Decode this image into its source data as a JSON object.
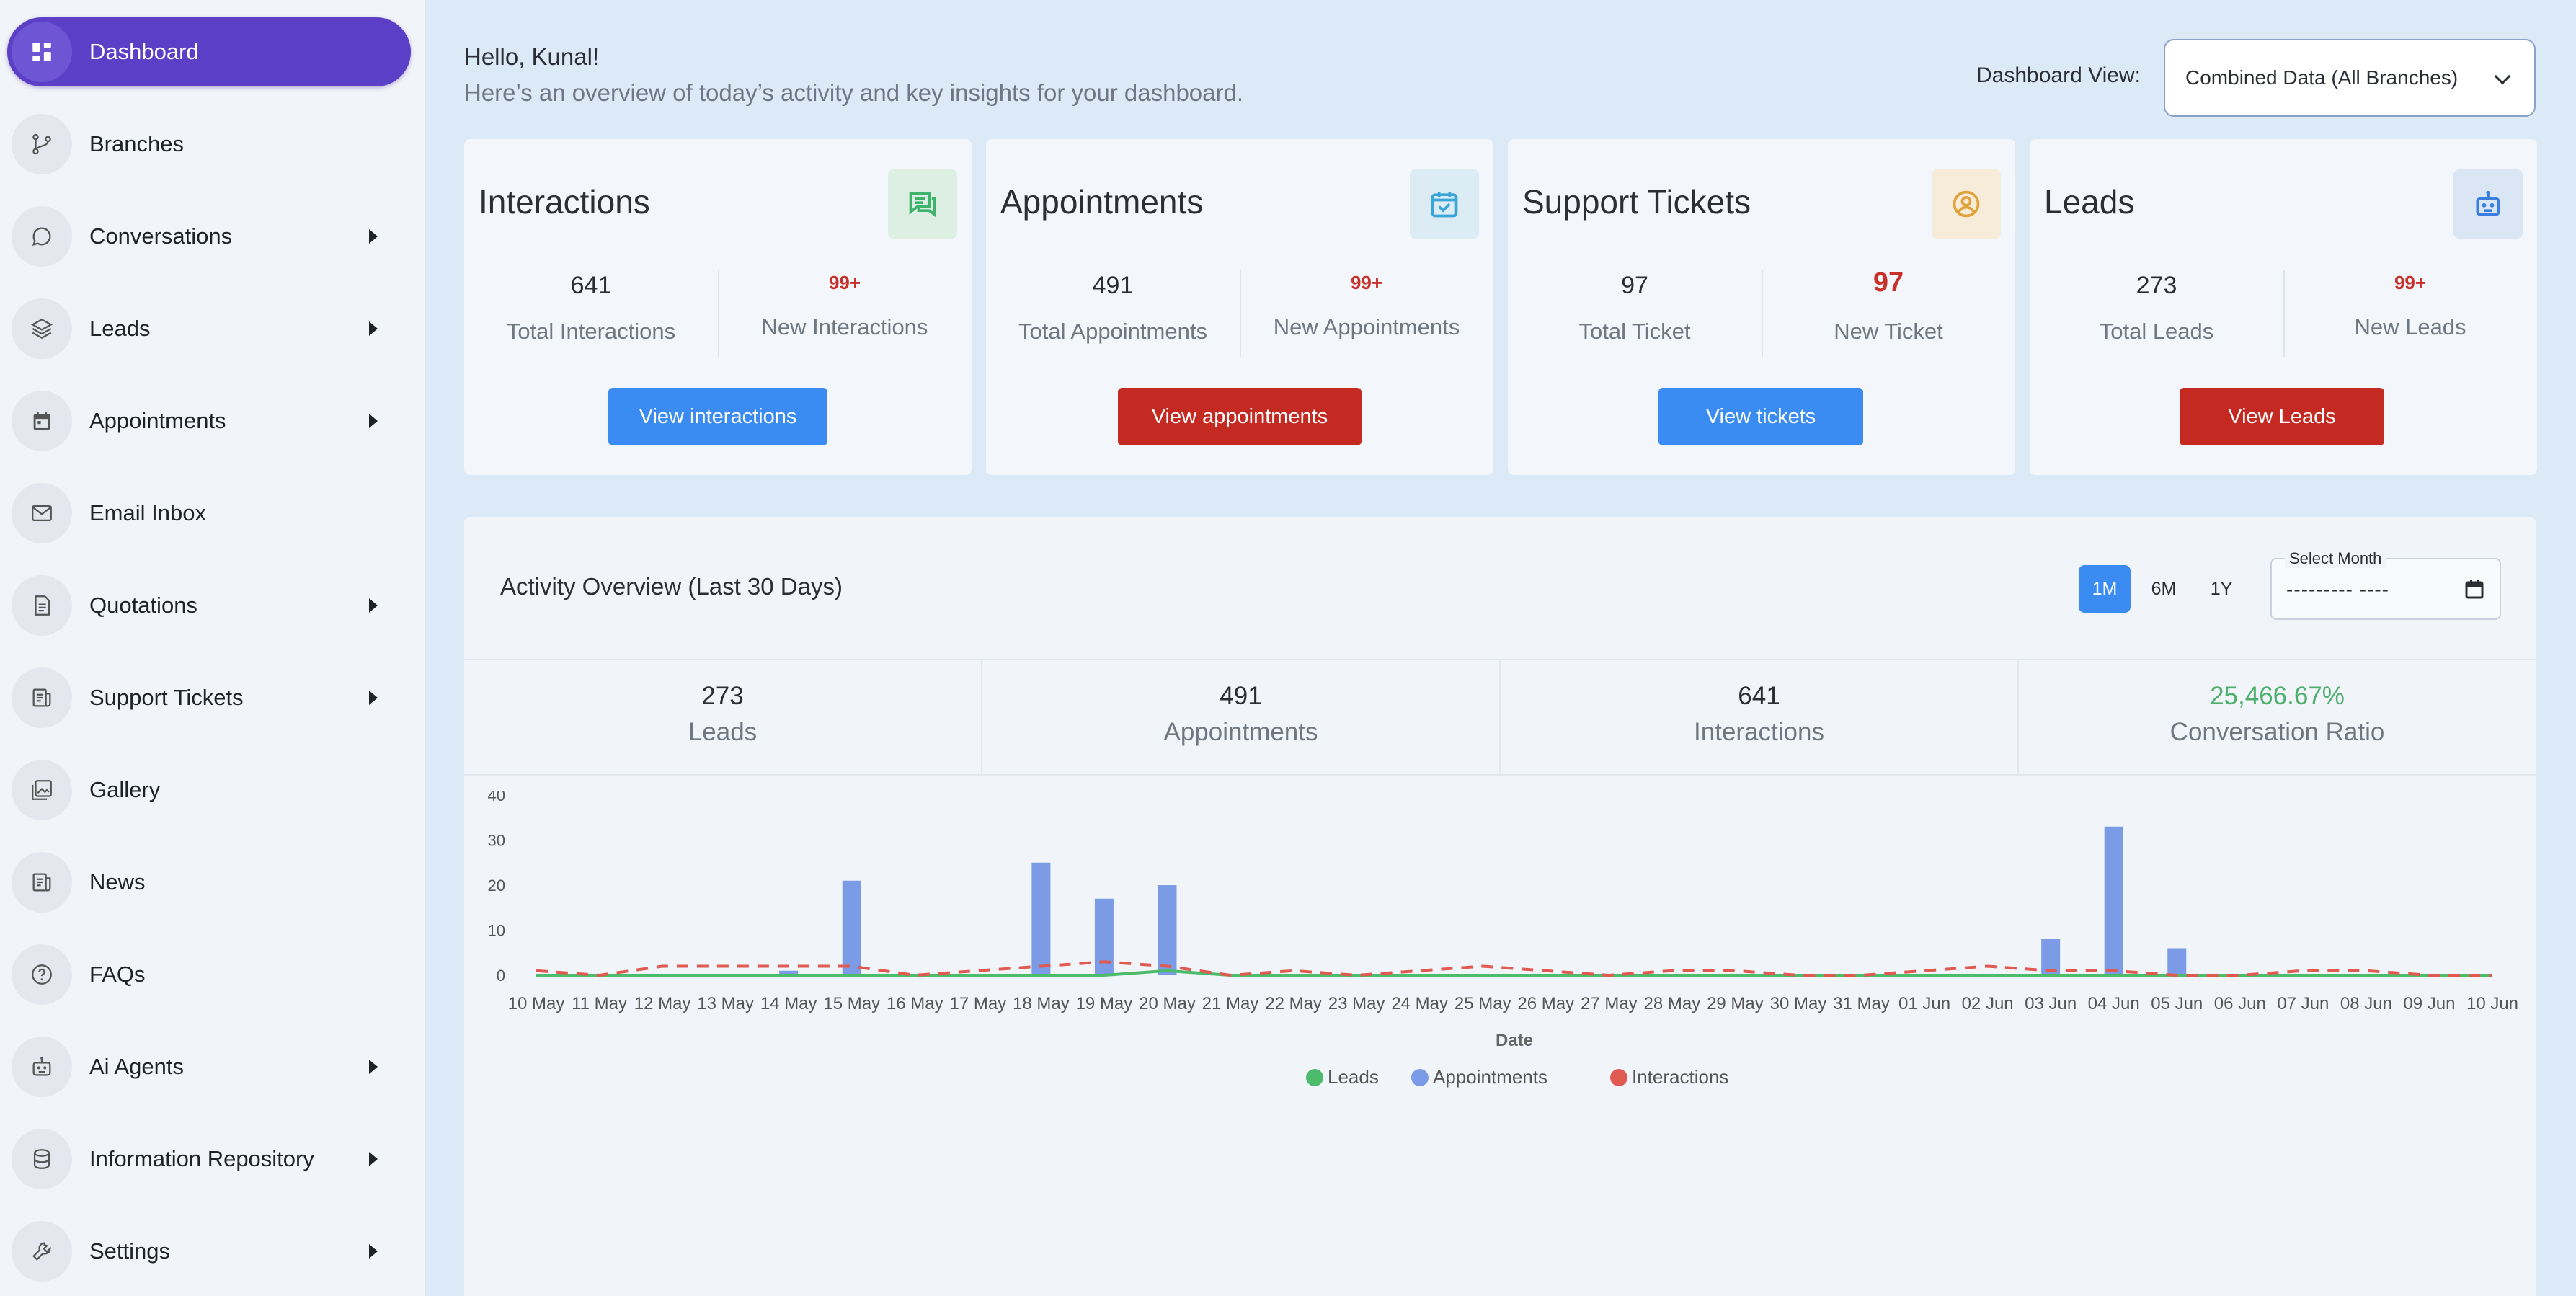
{
  "sidebar": {
    "items": [
      {
        "label": "Dashboard",
        "icon": "dashboard-icon",
        "active": true,
        "has_arrow": false
      },
      {
        "label": "Branches",
        "icon": "branch-icon",
        "active": false,
        "has_arrow": false
      },
      {
        "label": "Conversations",
        "icon": "chat-bubble-icon",
        "active": false,
        "has_arrow": true
      },
      {
        "label": "Leads",
        "icon": "layers-icon",
        "active": false,
        "has_arrow": true
      },
      {
        "label": "Appointments",
        "icon": "calendar-icon",
        "active": false,
        "has_arrow": true
      },
      {
        "label": "Email Inbox",
        "icon": "mail-icon",
        "active": false,
        "has_arrow": false
      },
      {
        "label": "Quotations",
        "icon": "document-icon",
        "active": false,
        "has_arrow": true
      },
      {
        "label": "Support Tickets",
        "icon": "ticket-icon",
        "active": false,
        "has_arrow": true
      },
      {
        "label": "Gallery",
        "icon": "gallery-icon",
        "active": false,
        "has_arrow": false
      },
      {
        "label": "News",
        "icon": "news-icon",
        "active": false,
        "has_arrow": false
      },
      {
        "label": "FAQs",
        "icon": "question-icon",
        "active": false,
        "has_arrow": false
      },
      {
        "label": "Ai Agents",
        "icon": "robot-icon",
        "active": false,
        "has_arrow": true
      },
      {
        "label": "Information Repository",
        "icon": "database-icon",
        "active": false,
        "has_arrow": true
      },
      {
        "label": "Settings",
        "icon": "wrench-icon",
        "active": false,
        "has_arrow": true
      }
    ]
  },
  "header": {
    "greeting": "Hello, Kunal!",
    "subtitle": "Here’s an overview of today’s activity and key insights for your dashboard.",
    "view_label": "Dashboard View:",
    "view_value": "Combined Data (All Branches)"
  },
  "cards": [
    {
      "title": "Interactions",
      "icon": "chat-icon",
      "icon_color": "#3db36b",
      "icon_bg": "#dcefe2",
      "total": "641",
      "total_label": "Total Interactions",
      "new": "99+",
      "new_label": "New Interactions",
      "button": "View interactions",
      "button_color": "#3a8cf2"
    },
    {
      "title": "Appointments",
      "icon": "calendar-check-icon",
      "icon_color": "#3aa6d8",
      "icon_bg": "#dcecf4",
      "total": "491",
      "total_label": "Total Appointments",
      "new": "99+",
      "new_label": "New Appointments",
      "button": "View appointments",
      "button_color": "#c42a21"
    },
    {
      "title": "Support Tickets",
      "icon": "user-circle-icon",
      "icon_color": "#e0a23a",
      "icon_bg": "#f6ecd9",
      "total": "97",
      "total_label": "Total Ticket",
      "new": "97",
      "new_label": "New Ticket",
      "button": "View tickets",
      "button_color": "#3a8cf2"
    },
    {
      "title": "Leads",
      "icon": "robot-icon",
      "icon_color": "#3a7fe0",
      "icon_bg": "#dbe6f5",
      "total": "273",
      "total_label": "Total Leads",
      "new": "99+",
      "new_label": "New Leads",
      "button": "View Leads",
      "button_color": "#c42a21"
    }
  ],
  "activity": {
    "title": "Activity Overview (Last 30 Days)",
    "ranges": [
      "1M",
      "6M",
      "1Y"
    ],
    "active_range": "1M",
    "month_label": "Select Month",
    "month_value": "--------- ----",
    "summary": [
      {
        "value": "273",
        "label": "Leads",
        "highlight": false
      },
      {
        "value": "491",
        "label": "Appointments",
        "highlight": false
      },
      {
        "value": "641",
        "label": "Interactions",
        "highlight": false
      },
      {
        "value": "25,466.67%",
        "label": "Conversation Ratio",
        "highlight": true
      }
    ]
  },
  "chart_data": {
    "type": "bar",
    "title": "",
    "xlabel": "Date",
    "ylabel": "",
    "ylim": [
      0,
      40
    ],
    "yticks": [
      0,
      10,
      20,
      30,
      40
    ],
    "categories": [
      "10 May",
      "11 May",
      "12 May",
      "13 May",
      "14 May",
      "15 May",
      "16 May",
      "17 May",
      "18 May",
      "19 May",
      "20 May",
      "21 May",
      "22 May",
      "23 May",
      "24 May",
      "25 May",
      "26 May",
      "27 May",
      "28 May",
      "29 May",
      "30 May",
      "31 May",
      "01 Jun",
      "02 Jun",
      "03 Jun",
      "04 Jun",
      "05 Jun",
      "06 Jun",
      "07 Jun",
      "08 Jun",
      "09 Jun",
      "10 Jun"
    ],
    "series": [
      {
        "name": "Leads",
        "kind": "line",
        "color": "#4cbb6c",
        "values": [
          0,
          0,
          0,
          0,
          0,
          0,
          0,
          0,
          0,
          0,
          1,
          0,
          0,
          0,
          0,
          0,
          0,
          0,
          0,
          0,
          0,
          0,
          0,
          0,
          0,
          0,
          0,
          0,
          0,
          0,
          0,
          0
        ]
      },
      {
        "name": "Appointments",
        "kind": "bar",
        "color": "#7b9be6",
        "values": [
          0,
          0,
          0,
          0,
          1,
          21,
          0,
          0,
          25,
          17,
          20,
          0,
          0,
          0,
          0,
          0,
          0,
          0,
          0,
          0,
          0,
          0,
          0,
          0,
          8,
          33,
          6,
          0,
          0,
          0,
          0,
          0
        ]
      },
      {
        "name": "Interactions",
        "kind": "dashed-line",
        "color": "#e05a52",
        "values": [
          1,
          0,
          2,
          2,
          2,
          2,
          0,
          1,
          2,
          3,
          2,
          0,
          1,
          0,
          1,
          2,
          1,
          0,
          1,
          1,
          0,
          0,
          1,
          2,
          1,
          1,
          0,
          0,
          1,
          1,
          0,
          0
        ]
      }
    ],
    "legend": "bottom",
    "grid": false
  }
}
